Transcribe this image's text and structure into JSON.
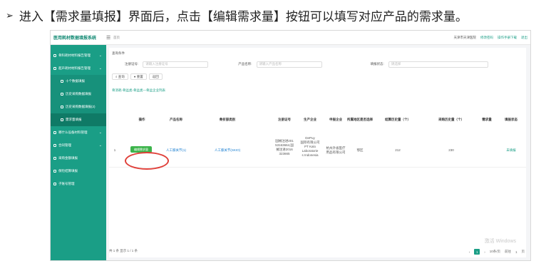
{
  "instruction": {
    "bullet": "➢",
    "text": "进入【需求量填报】界面后，点击【编辑需求量】按钮可以填写对应产品的需求量。"
  },
  "app": {
    "title": "医用耗材数据填报系统",
    "breadcrumb": "首页",
    "header_links": [
      "天津市天津医院",
      "修改密码",
      "操作手册下载",
      "退出"
    ]
  },
  "sidebar": {
    "items": [
      {
        "label": "骨科耗材材料报告管理",
        "level": 1,
        "caret": "⌄"
      },
      {
        "label": "超声耗材材料报告管理",
        "level": 1,
        "caret": "⌄"
      },
      {
        "label": "十个数据填报",
        "level": 2
      },
      {
        "label": "历史采购数据填报",
        "level": 2
      },
      {
        "label": "历史采购数据填报(2)",
        "level": 2
      },
      {
        "label": "需求量填报",
        "level": 2,
        "active": true
      },
      {
        "label": "哪什么设备材料管理",
        "level": 1,
        "caret": "⌄"
      },
      {
        "label": "合同管理",
        "level": 1,
        "caret": "⌄"
      },
      {
        "label": "采购金额填报",
        "level": 1
      },
      {
        "label": "保险结算填报",
        "level": 1
      },
      {
        "label": "子账号管理",
        "level": 1
      }
    ]
  },
  "search": {
    "section_title": "查询条件",
    "fields": [
      {
        "label": "注册证号:",
        "placeholder": "请输入注册证号"
      },
      {
        "label": "产品名称:",
        "placeholder": "请输入产品名称"
      },
      {
        "label": "填报状态:",
        "placeholder": "请选择"
      }
    ],
    "buttons": [
      "查询",
      "重置",
      "返回"
    ]
  },
  "table": {
    "title": "骨消耗-骨盆类-骨盆类—骨盆企业列表",
    "columns": [
      "操作",
      "产品名称",
      "骨折部类别",
      "注册证号",
      "生产企业",
      "申报企业",
      "所属地区是否选择",
      "结算历史量（个）",
      "采购历史量（个）",
      "需求量",
      "填报状态"
    ],
    "rows": [
      {
        "index": "1",
        "action": "编辑需求量",
        "product": "人工膝关节(1)",
        "category": "人工膝关节(SKIO)",
        "registration": "国械注进201\n53163664,国\n械注进2016\n323665",
        "manufacturer": "DePuy\n国际有限公司\nPT Kalo\nLaboratorie\ns Indonesia",
        "declarant": "杭州外省医疗\n用品有限公司",
        "region": "鄂区",
        "settled_qty": "212",
        "purchase_qty": "230",
        "demand": "",
        "status": "未填报"
      }
    ]
  },
  "pagination": {
    "total_text": "共 1 条 显示 1 / 1 条",
    "current_page": "1",
    "page_size": "10条/页",
    "goto_label": "前往",
    "goto_value": "1",
    "page_suffix": "页"
  },
  "watermark": "激活 Windows"
}
